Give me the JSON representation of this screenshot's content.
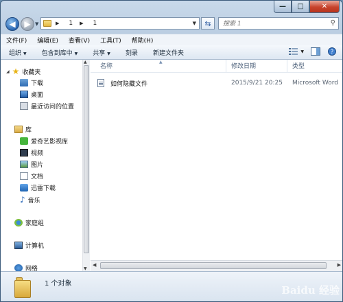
{
  "window": {
    "controls": {
      "minimize": "—",
      "maximize": "□",
      "close": "✕"
    }
  },
  "address": {
    "path": [
      "1",
      "1"
    ],
    "back_icon": "back-arrow-icon",
    "forward_icon": "forward-arrow-icon",
    "refresh_icon": "refresh-icon"
  },
  "search": {
    "placeholder": "搜索 1"
  },
  "menubar": {
    "items": [
      "文件(F)",
      "编辑(E)",
      "查看(V)",
      "工具(T)",
      "帮助(H)"
    ]
  },
  "toolbar": {
    "organize": "组织",
    "include_in_library": "包含到库中",
    "share": "共享",
    "burn": "刻录",
    "new_folder": "新建文件夹"
  },
  "navigation": {
    "favorites": {
      "label": "收藏夹",
      "items": [
        "下载",
        "桌面",
        "最近访问的位置"
      ]
    },
    "libraries": {
      "label": "库",
      "items": [
        "爱奇艺影视库",
        "视频",
        "图片",
        "文档",
        "迅雷下载",
        "音乐"
      ]
    },
    "homegroup": "家庭组",
    "computer": "计算机",
    "network": "网络"
  },
  "columns": {
    "name": "名称",
    "modified": "修改日期",
    "type": "类型"
  },
  "files": [
    {
      "name": "如何隐藏文件",
      "modified": "2015/9/21 20:25",
      "type": "Microsoft Word"
    }
  ],
  "details": {
    "count": "1 个对象"
  },
  "watermark": "Baidu 经验"
}
